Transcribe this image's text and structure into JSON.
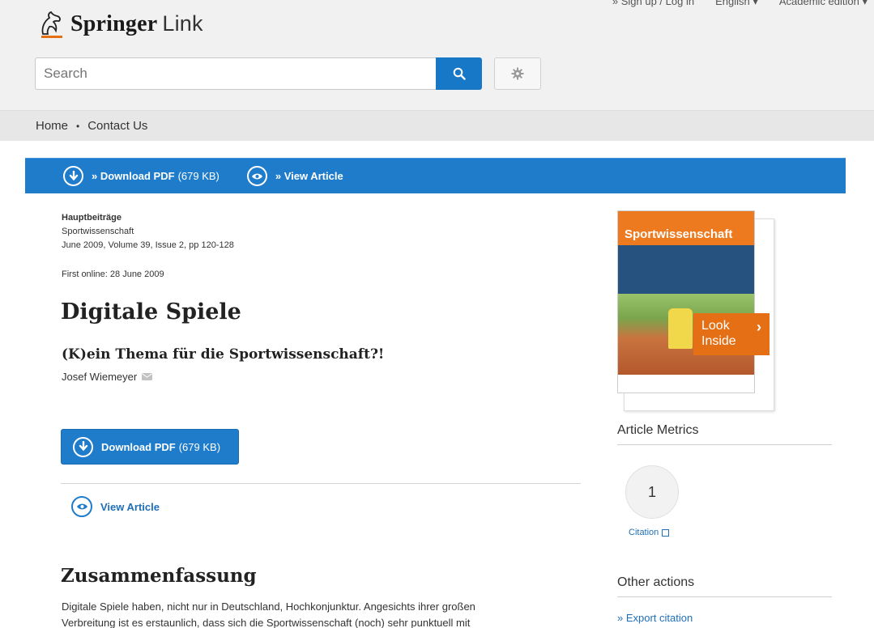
{
  "header": {
    "logo_main": "Springer",
    "logo_sub": "Link",
    "top_links": [
      "» Sign up / Log in",
      "English ▾",
      "Academic edition ▾"
    ],
    "search": {
      "placeholder": "Search"
    }
  },
  "nav": {
    "home": "Home",
    "separator": "•",
    "contact": "Contact Us"
  },
  "bluebar": {
    "download_label": "» Download PDF",
    "download_size": "(679 KB)",
    "view_label": "» View Article"
  },
  "article": {
    "section": "Hauptbeiträge",
    "journal": "Sportwissenschaft",
    "issue": "June 2009, Volume 39, Issue 2, pp 120-128",
    "first_online": "First online: 28 June 2009",
    "title": "Digitale Spiele",
    "subtitle": "(K)ein Thema für die Sportwissenschaft?!",
    "author": "Josef Wiemeyer",
    "download_label": "Download PDF",
    "download_size": "(679 KB)",
    "view_label": "View Article",
    "abstract_heading": "Zusammenfassung",
    "abstract_line1": "Digitale Spiele haben, nicht nur in Deutschland, Hochkonjunktur. Angesichts ihrer großen",
    "abstract_line2": "Verbreitung ist es erstaunlich, dass sich die Sportwissenschaft (noch) sehr punktuell mit"
  },
  "sidebar": {
    "cover_title": "Sportwissenschaft",
    "look_inside_1": "Look",
    "look_inside_2": "Inside",
    "metrics_heading": "Article Metrics",
    "citation_count": "1",
    "citation_label": "Citation",
    "other_heading": "Other actions",
    "export_label": "» Export citation"
  },
  "colors": {
    "brand_blue": "#1e7ccb",
    "orange": "#e56f15"
  }
}
